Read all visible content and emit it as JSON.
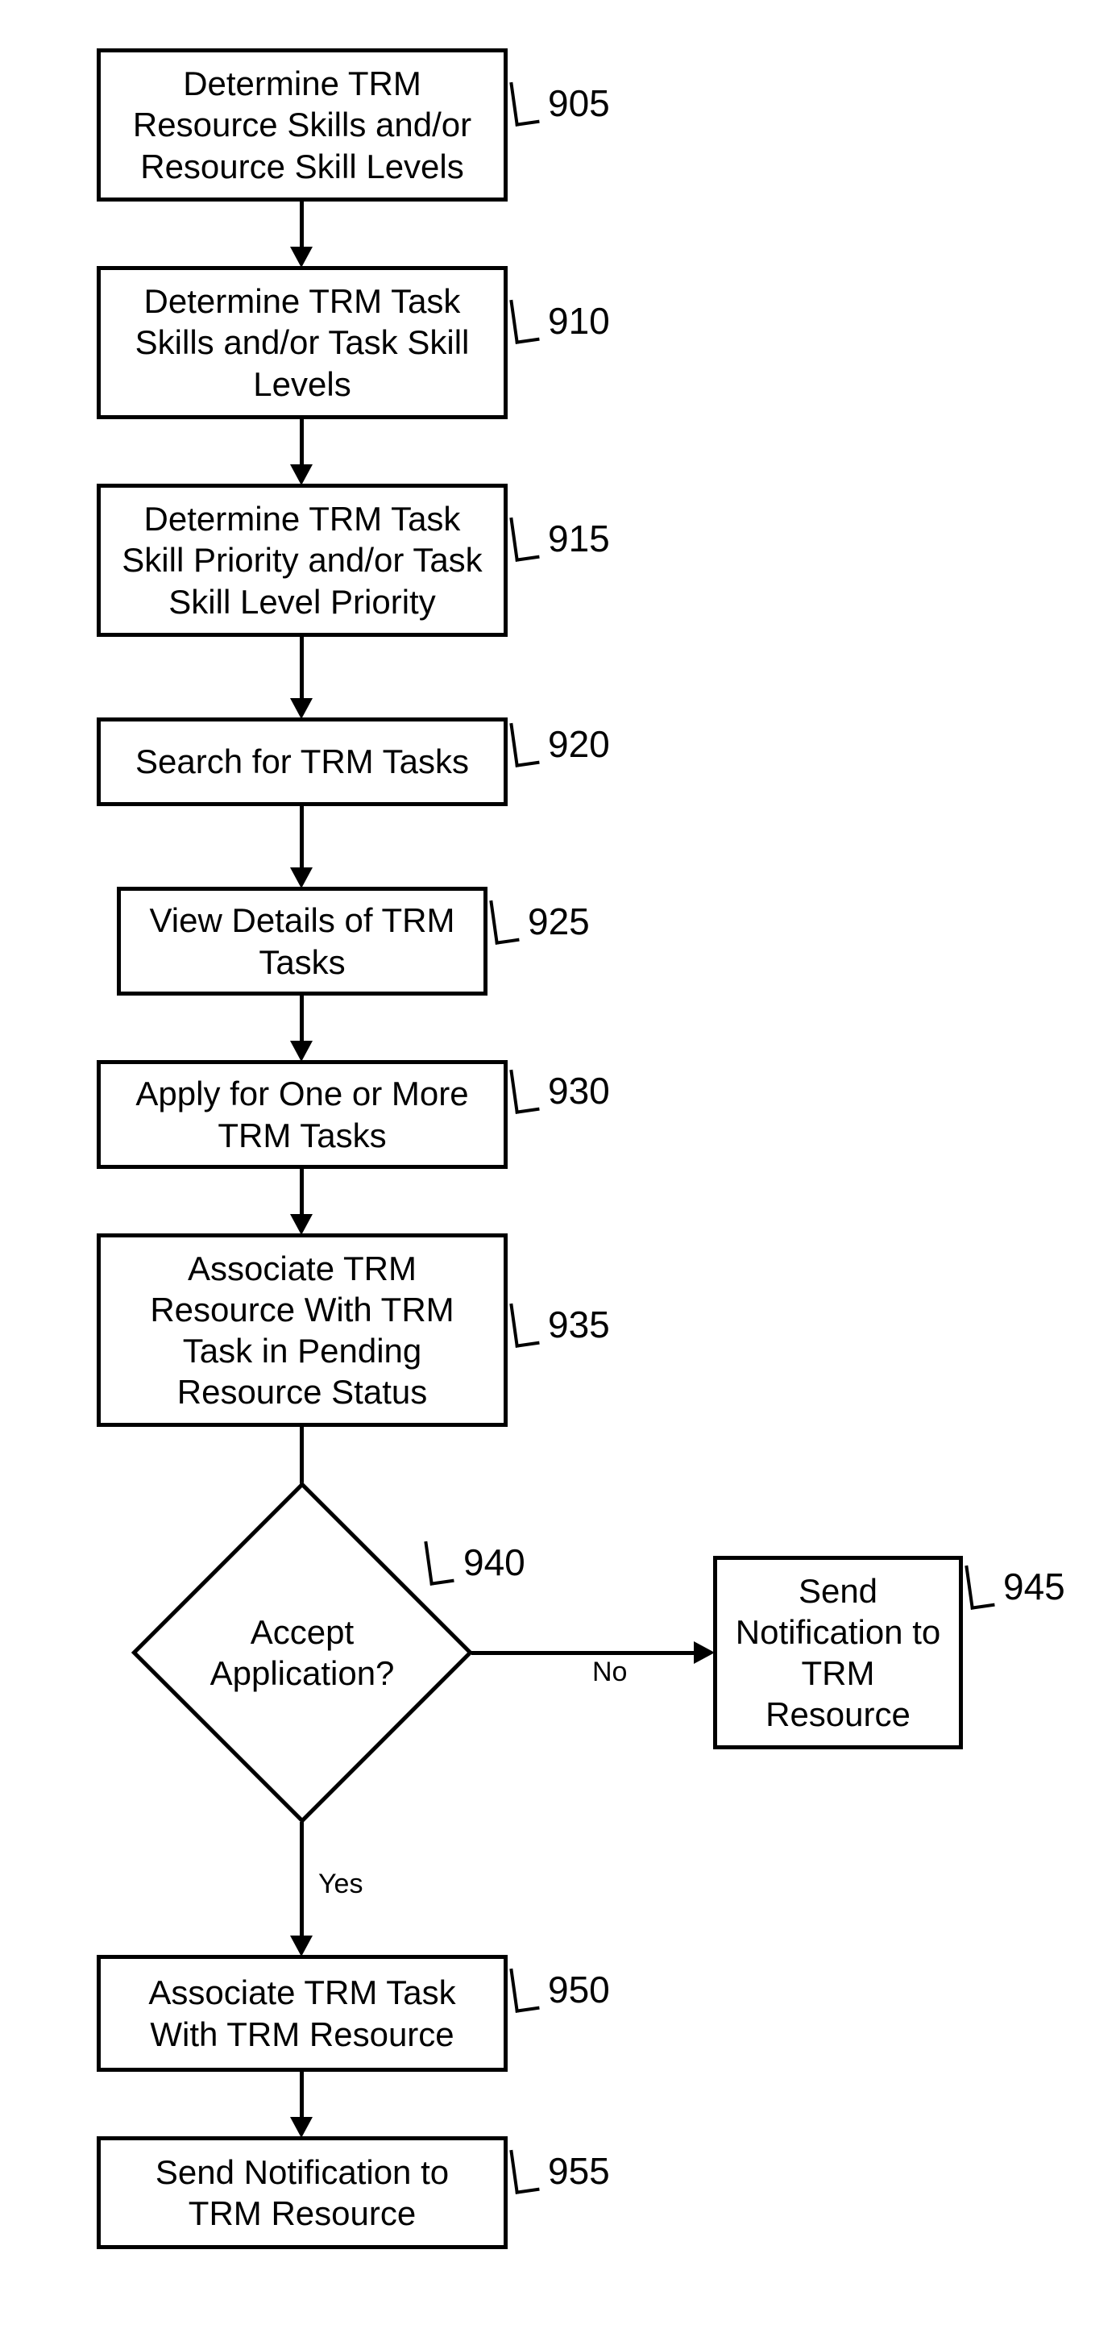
{
  "nodes": {
    "n905": {
      "text": "Determine TRM Resource Skills and/or Resource Skill Levels",
      "num": "905"
    },
    "n910": {
      "text": "Determine TRM Task Skills and/or Task Skill Levels",
      "num": "910"
    },
    "n915": {
      "text": "Determine TRM Task Skill Priority and/or Task Skill Level Priority",
      "num": "915"
    },
    "n920": {
      "text": "Search for TRM Tasks",
      "num": "920"
    },
    "n925": {
      "text": "View Details of TRM Tasks",
      "num": "925"
    },
    "n930": {
      "text": "Apply for One or More TRM Tasks",
      "num": "930"
    },
    "n935": {
      "text": "Associate TRM Resource With TRM Task in Pending Resource Status",
      "num": "935"
    },
    "n940": {
      "text": "Accept Application?",
      "num": "940"
    },
    "n945": {
      "text": "Send Notification to TRM Resource",
      "num": "945"
    },
    "n950": {
      "text": "Associate TRM Task With TRM Resource",
      "num": "950"
    },
    "n955": {
      "text": "Send Notification to TRM Resource",
      "num": "955"
    }
  },
  "edges": {
    "yes": "Yes",
    "no": "No"
  }
}
